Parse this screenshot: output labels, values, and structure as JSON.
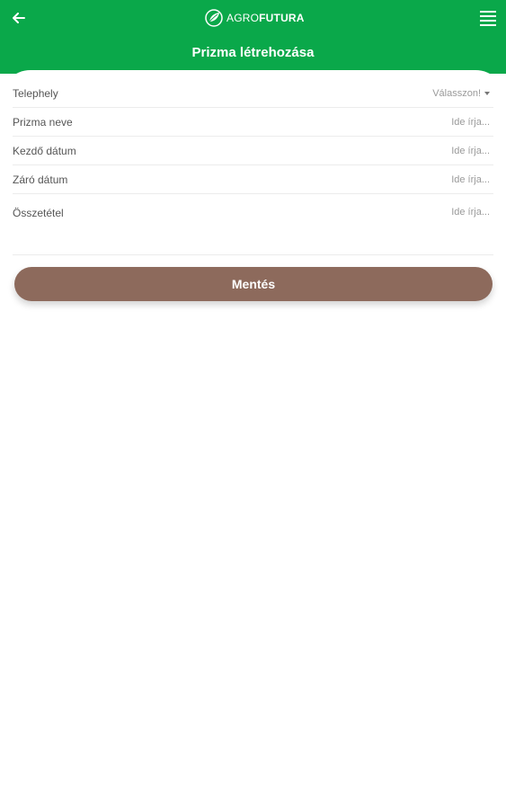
{
  "header": {
    "logo_light": "AGRO",
    "logo_bold": "FUTURA",
    "title": "Prizma létrehozása",
    "back_icon": "arrow-left-icon",
    "menu_icon": "hamburger-menu-icon",
    "color": "#0aa84a"
  },
  "form": {
    "fields": [
      {
        "label": "Telephely",
        "value": "Válasszon!",
        "type": "select"
      },
      {
        "label": "Prizma neve",
        "value": "Ide írja...",
        "type": "text"
      },
      {
        "label": "Kezdő dátum",
        "value": "Ide írja...",
        "type": "date"
      },
      {
        "label": "Záró dátum",
        "value": "Ide írja...",
        "type": "date"
      },
      {
        "label": "Összetétel",
        "value": "Ide írja...",
        "type": "textarea"
      }
    ]
  },
  "actions": {
    "save_label": "Mentés",
    "save_color": "#8d6a5c"
  }
}
